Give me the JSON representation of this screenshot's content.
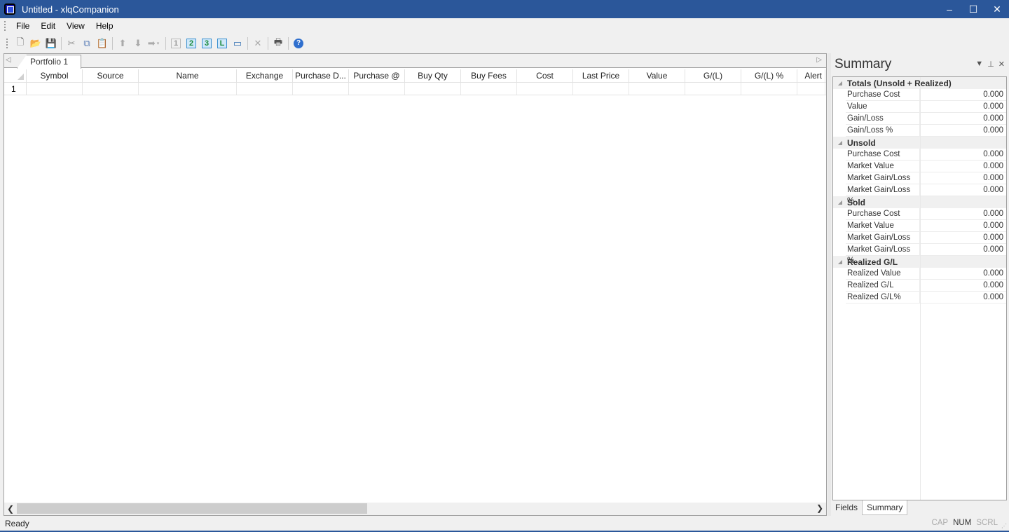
{
  "window": {
    "title": "Untitled - xlqCompanion",
    "controls": {
      "minimize": "‒",
      "maximize": "☐",
      "close": "✕"
    }
  },
  "menu": [
    "File",
    "Edit",
    "View",
    "Help"
  ],
  "toolbar": {
    "buttons": [
      {
        "name": "new-icon",
        "glyph": "🗋"
      },
      {
        "name": "open-icon",
        "glyph": "📂"
      },
      {
        "name": "save-icon",
        "glyph": "💾"
      },
      {
        "name": "cut-icon",
        "glyph": "✂"
      },
      {
        "name": "copy-icon",
        "glyph": "⧉"
      },
      {
        "name": "paste-icon",
        "glyph": "📋"
      },
      {
        "name": "move-up-icon",
        "glyph": "⬆"
      },
      {
        "name": "move-down-icon",
        "glyph": "⬇"
      },
      {
        "name": "move-right-icon",
        "glyph": "➡"
      },
      {
        "name": "portfolio-1-icon",
        "glyph": "1"
      },
      {
        "name": "portfolio-2-icon",
        "glyph": "2"
      },
      {
        "name": "portfolio-3-icon",
        "glyph": "3"
      },
      {
        "name": "portfolio-l-icon",
        "glyph": "L"
      },
      {
        "name": "window-icon",
        "glyph": "▭"
      },
      {
        "name": "delete-icon",
        "glyph": "✕"
      },
      {
        "name": "print-icon",
        "glyph": "🖶"
      },
      {
        "name": "help-icon",
        "glyph": "?"
      }
    ]
  },
  "document": {
    "tabs": [
      {
        "label": "Portfolio 1",
        "active": true
      }
    ],
    "columns": [
      "Symbol",
      "Source",
      "Name",
      "Exchange",
      "Purchase D...",
      "Purchase @",
      "Buy Qty",
      "Buy Fees",
      "Cost",
      "Last Price",
      "Value",
      "G/(L)",
      "G/(L) %",
      "Alert"
    ],
    "rows": [
      {
        "number": "1"
      }
    ]
  },
  "summary_panel": {
    "title": "Summary",
    "categories": [
      {
        "label": "Totals (Unsold + Realized)",
        "items": [
          {
            "name": "Purchase Cost",
            "value": "0.000"
          },
          {
            "name": "Value",
            "value": "0.000"
          },
          {
            "name": "Gain/Loss",
            "value": "0.000"
          },
          {
            "name": "Gain/Loss %",
            "value": "0.000"
          }
        ]
      },
      {
        "label": "Unsold",
        "items": [
          {
            "name": "Purchase Cost",
            "value": "0.000"
          },
          {
            "name": "Market Value",
            "value": "0.000"
          },
          {
            "name": "Market Gain/Loss",
            "value": "0.000"
          },
          {
            "name": "Market Gain/Loss %",
            "value": "0.000"
          }
        ]
      },
      {
        "label": "Sold",
        "items": [
          {
            "name": "Purchase Cost",
            "value": "0.000"
          },
          {
            "name": "Market Value",
            "value": "0.000"
          },
          {
            "name": "Market Gain/Loss",
            "value": "0.000"
          },
          {
            "name": "Market Gain/Loss %",
            "value": "0.000"
          }
        ]
      },
      {
        "label": "Realized G/L",
        "items": [
          {
            "name": "Realized Value",
            "value": "0.000"
          },
          {
            "name": "Realized G/L",
            "value": "0.000"
          },
          {
            "name": "Realized G/L%",
            "value": "0.000"
          }
        ]
      }
    ],
    "tabs": [
      {
        "label": "Fields",
        "active": false
      },
      {
        "label": "Summary",
        "active": true
      }
    ]
  },
  "statusbar": {
    "text": "Ready",
    "indicators": [
      {
        "label": "CAP",
        "on": false
      },
      {
        "label": "NUM",
        "on": true
      },
      {
        "label": "SCRL",
        "on": false
      }
    ]
  },
  "colors": {
    "titlebar": "#2b579a",
    "background": "#f0f0f0"
  }
}
